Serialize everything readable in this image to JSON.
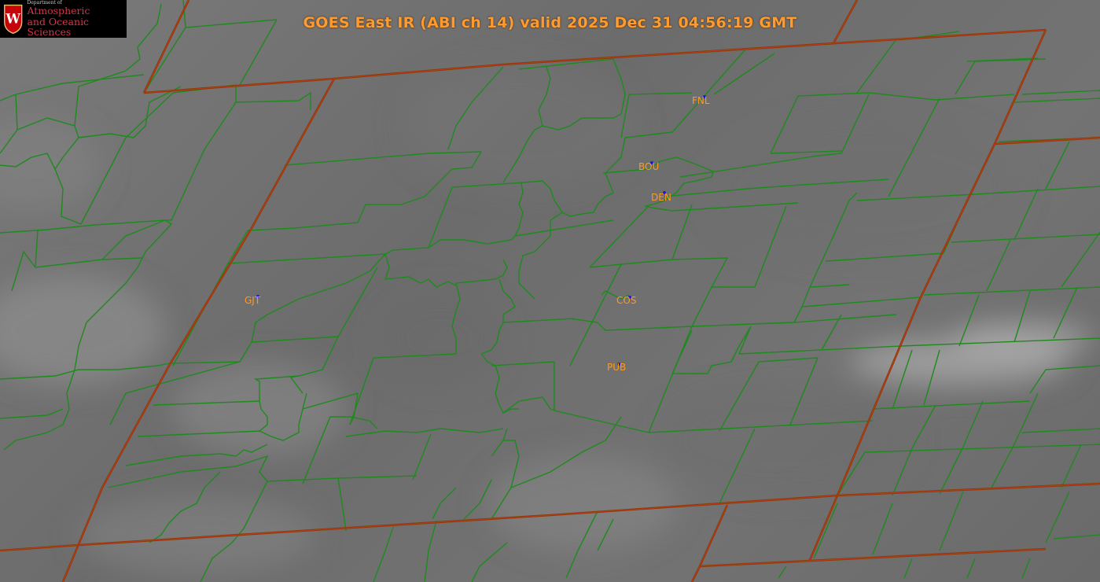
{
  "title": "GOES East IR (ABI ch 14) valid 2025 Dec 31 04:56:19 GMT",
  "logo": {
    "dept": "Department of",
    "line1": "Atmospheric",
    "line2": "and Oceanic Sciences",
    "crest_letter": "W"
  },
  "stations": [
    {
      "id": "FNL",
      "label": "FNL"
    },
    {
      "id": "BOU",
      "label": "BOU"
    },
    {
      "id": "DEN",
      "label": "DEN"
    },
    {
      "id": "GJT",
      "label": "GJT"
    },
    {
      "id": "COS",
      "label": "COS"
    },
    {
      "id": "PUB",
      "label": "PUB"
    }
  ],
  "colors": {
    "county_line": "#1e8a1e",
    "state_line": "#8a3a0a",
    "state_highlight": "#c83a1a",
    "station_label": "#ff9a1e",
    "station_dot": "#1a1ae0",
    "title": "#ff9a2e"
  }
}
